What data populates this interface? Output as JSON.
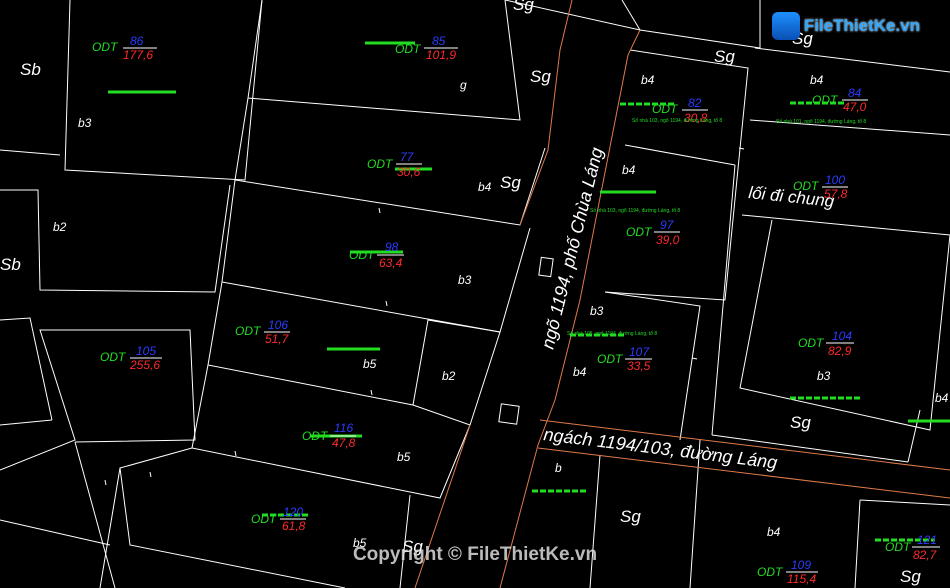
{
  "roads": [
    {
      "id": "road-lane-1194",
      "label": "ngõ 1194, phố Chùa Láng"
    },
    {
      "id": "road-alley-103",
      "label": "ngách 1194/103, đường Láng"
    }
  ],
  "area_labels": [
    {
      "id": "sb-1",
      "text": "Sb"
    },
    {
      "id": "sb-2",
      "text": "Sb"
    },
    {
      "id": "sg-1",
      "text": "Sg"
    },
    {
      "id": "sg-2",
      "text": "Sg"
    },
    {
      "id": "sg-3",
      "text": "Sg"
    },
    {
      "id": "sg-4",
      "text": "Sg"
    },
    {
      "id": "sg-5",
      "text": "Sg"
    },
    {
      "id": "sg-6",
      "text": "Sg"
    },
    {
      "id": "sg-7",
      "text": "Sg"
    },
    {
      "id": "sg-8",
      "text": "Sg"
    },
    {
      "id": "sg-9",
      "text": "Sg"
    },
    {
      "id": "common-way",
      "text": "lối đi chung"
    }
  ],
  "parcels": [
    {
      "type": "ODT",
      "number": "86",
      "area": "177,6"
    },
    {
      "type": "ODT",
      "number": "85",
      "area": "101,9"
    },
    {
      "type": "ODT",
      "number": "77",
      "area": "30,6"
    },
    {
      "type": "ODT",
      "number": "98",
      "area": "63,4"
    },
    {
      "type": "ODT",
      "number": "106",
      "area": "51,7"
    },
    {
      "type": "ODT",
      "number": "105",
      "area": "255,6"
    },
    {
      "type": "ODT",
      "number": "116",
      "area": "47,8"
    },
    {
      "type": "ODT",
      "number": "120",
      "area": "61,8"
    },
    {
      "type": "ODT",
      "number": "82",
      "area": "30,8"
    },
    {
      "type": "ODT",
      "number": "84",
      "area": "47,0"
    },
    {
      "type": "ODT",
      "number": "100",
      "area": "57,8"
    },
    {
      "type": "ODT",
      "number": "97",
      "area": "39,0"
    },
    {
      "type": "ODT",
      "number": "107",
      "area": "33,5"
    },
    {
      "type": "ODT",
      "number": "104",
      "area": "82,9"
    },
    {
      "type": "ODT",
      "number": "109",
      "area": "115,4"
    },
    {
      "type": "ODT",
      "number": "121",
      "area": "82,7"
    }
  ],
  "height_codes": [
    "b3",
    "b2",
    "g",
    "b4",
    "b3",
    "b5",
    "b2",
    "b5",
    "b5",
    "b4",
    "b4",
    "b4",
    "b3",
    "b4",
    "b3",
    "b",
    "b4",
    "b4"
  ],
  "address_notes": [
    "Số nhà 103, ngõ 1194, đường Láng, tổ 8",
    "Số nhà 101, ngõ 1194, đường Láng, tổ 8",
    "Số nhà 103, ngõ 1194, đường Láng, tổ 8",
    "Số nhà 105, ngõ 1194, đường Láng, tổ 8"
  ],
  "watermark": {
    "logo": "FileThietKe.vn",
    "copyright": "Copyright © FileThietKe.vn"
  },
  "colors": {
    "background": "#000000",
    "lines": "#ffffff",
    "road_edge": "#e07a4a",
    "odt": "#22dd22",
    "parcel_number": "#2a3cff",
    "area": "#ff2a2a",
    "text": "#ffffff"
  }
}
